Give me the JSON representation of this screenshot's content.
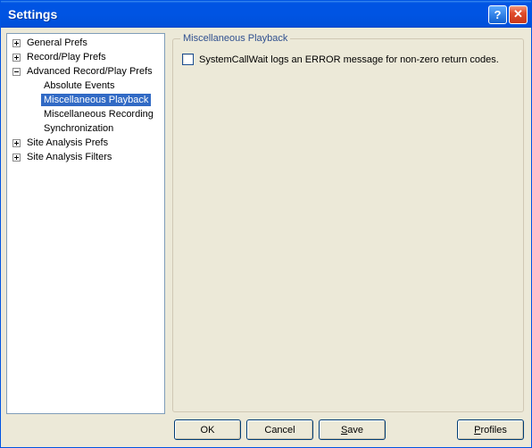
{
  "window": {
    "title": "Settings"
  },
  "tree": {
    "general": "General Prefs",
    "recordplay": "Record/Play Prefs",
    "advanced": "Advanced Record/Play Prefs",
    "advanced_children": {
      "absolute": "Absolute Events",
      "misc_playback": "Miscellaneous Playback",
      "misc_recording": "Miscellaneous Recording",
      "synchronization": "Synchronization"
    },
    "site_prefs": "Site Analysis Prefs",
    "site_filters": "Site Analysis Filters"
  },
  "panel": {
    "legend": "Miscellaneous Playback",
    "checkbox_label": "SystemCallWait logs an ERROR message for non-zero return codes."
  },
  "buttons": {
    "ok": "OK",
    "cancel": "Cancel",
    "save": "Save",
    "profiles": "Profiles"
  }
}
